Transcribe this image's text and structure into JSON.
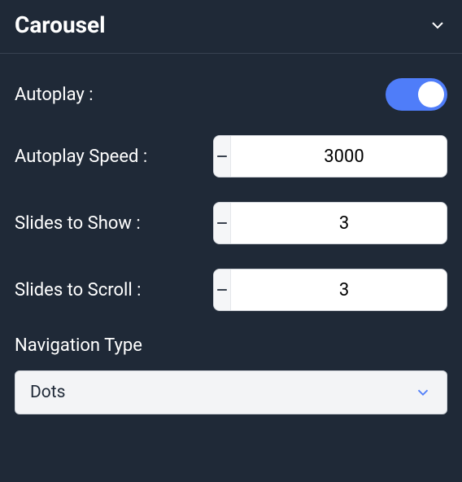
{
  "panel": {
    "title": "Carousel"
  },
  "settings": {
    "autoplay": {
      "label": "Autoplay :",
      "value": true
    },
    "autoplaySpeed": {
      "label": "Autoplay Speed :",
      "value": "3000"
    },
    "slidesToShow": {
      "label": "Slides to Show :",
      "value": "3"
    },
    "slidesToScroll": {
      "label": "Slides to Scroll :",
      "value": "3"
    },
    "navigationType": {
      "label": "Navigation Type",
      "value": "Dots"
    }
  }
}
